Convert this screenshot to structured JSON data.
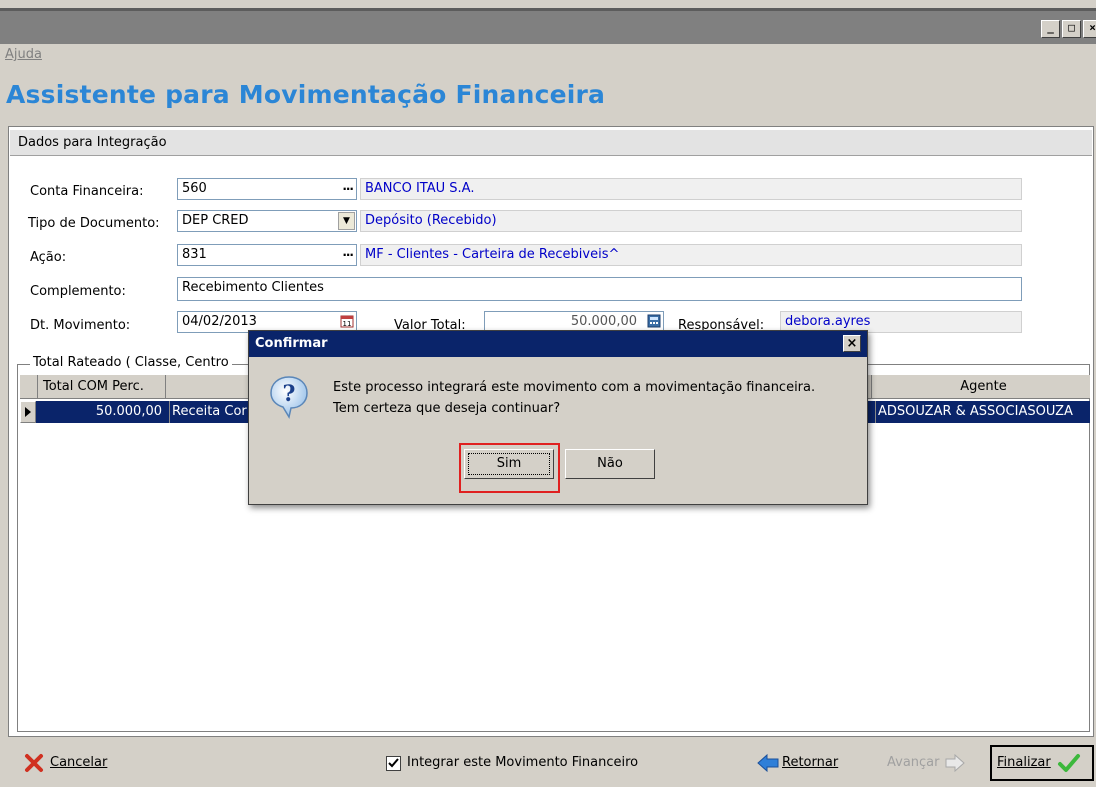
{
  "window": {
    "controls": [
      "_",
      "□",
      "×"
    ]
  },
  "menu": {
    "help": "Ajuda"
  },
  "title": "Assistente para Movimentação Financeira",
  "section": {
    "header": "Dados para Integração"
  },
  "form": {
    "conta_financeira": {
      "label": "Conta Financeira:",
      "value": "560",
      "desc": "BANCO ITAU S.A."
    },
    "tipo_documento": {
      "label": "Tipo de Documento:",
      "value": "DEP CRED",
      "desc": "Depósito (Recebido)"
    },
    "acao": {
      "label": "Ação:",
      "value": "831",
      "desc": "MF - Clientes - Carteira de Recebiveis^"
    },
    "complemento": {
      "label": "Complemento:",
      "value": "Recebimento Clientes"
    },
    "dt_movimento": {
      "label": "Dt. Movimento:",
      "value": "04/02/2013"
    },
    "valor_total": {
      "label": "Valor Total:",
      "value": "50.000,00"
    },
    "responsavel": {
      "label": "Responsável:",
      "value": "debora.ayres"
    }
  },
  "rateio": {
    "title": "Total Rateado ( Classe, Centro",
    "columns": [
      "Total COM Perc.",
      "",
      "Agente"
    ],
    "row": {
      "total": "50.000,00",
      "classe": "Receita Cor",
      "agente": "ADSOUZAR & ASSOCIASOUZA"
    }
  },
  "dialog": {
    "title": "Confirmar",
    "close": "×",
    "line1": "Este processo integrará este movimento com a movimentação financeira.",
    "line2": "Tem certeza que deseja continuar?",
    "yes": "Sim",
    "no": "Não"
  },
  "bottom": {
    "cancel": "Cancelar",
    "integrate": "Integrar este Movimento Financeiro",
    "integrate_checked": true,
    "back": "Retornar",
    "next": "Avançar",
    "finish": "Finalizar"
  },
  "colors": {
    "title_blue": "#2b86d6",
    "selection": "#0a246a",
    "link_blue": "#0000c8",
    "focus_red": "#e02020"
  }
}
